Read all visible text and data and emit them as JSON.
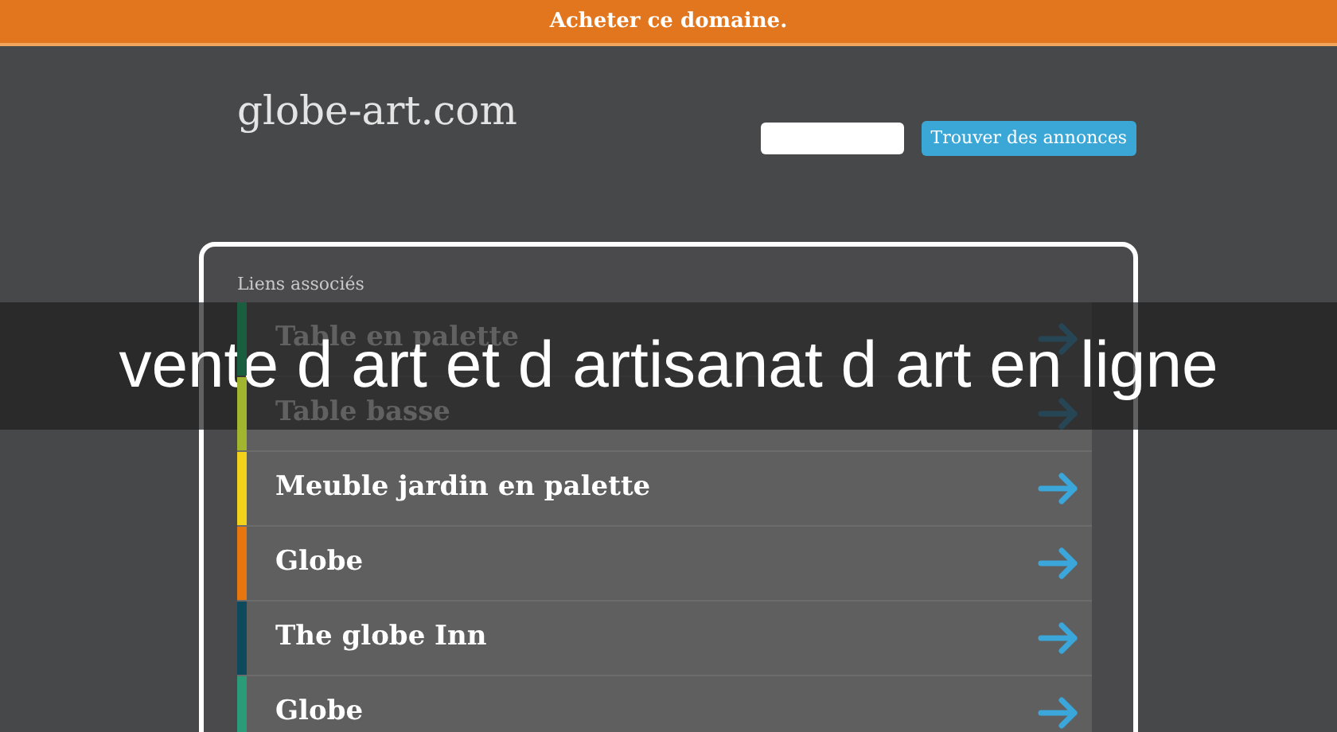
{
  "top_bar": {
    "label": "Acheter ce domaine."
  },
  "header": {
    "logo": "globe-art.com",
    "search_button": "Trouver des annonces"
  },
  "panel": {
    "title": "Liens associés",
    "links": [
      {
        "label": "Table en palette",
        "color": "#1b5e3f"
      },
      {
        "label": "Table basse",
        "color": "#a3b52e"
      },
      {
        "label": "Meuble jardin en palette",
        "color": "#f2d21a"
      },
      {
        "label": "Globe",
        "color": "#e8760f"
      },
      {
        "label": "The globe Inn",
        "color": "#0f4a5c"
      },
      {
        "label": "Globe",
        "color": "#2b9a78"
      }
    ]
  },
  "overlay_banner": {
    "text": "vente d art et d artisanat d art en ligne"
  }
}
